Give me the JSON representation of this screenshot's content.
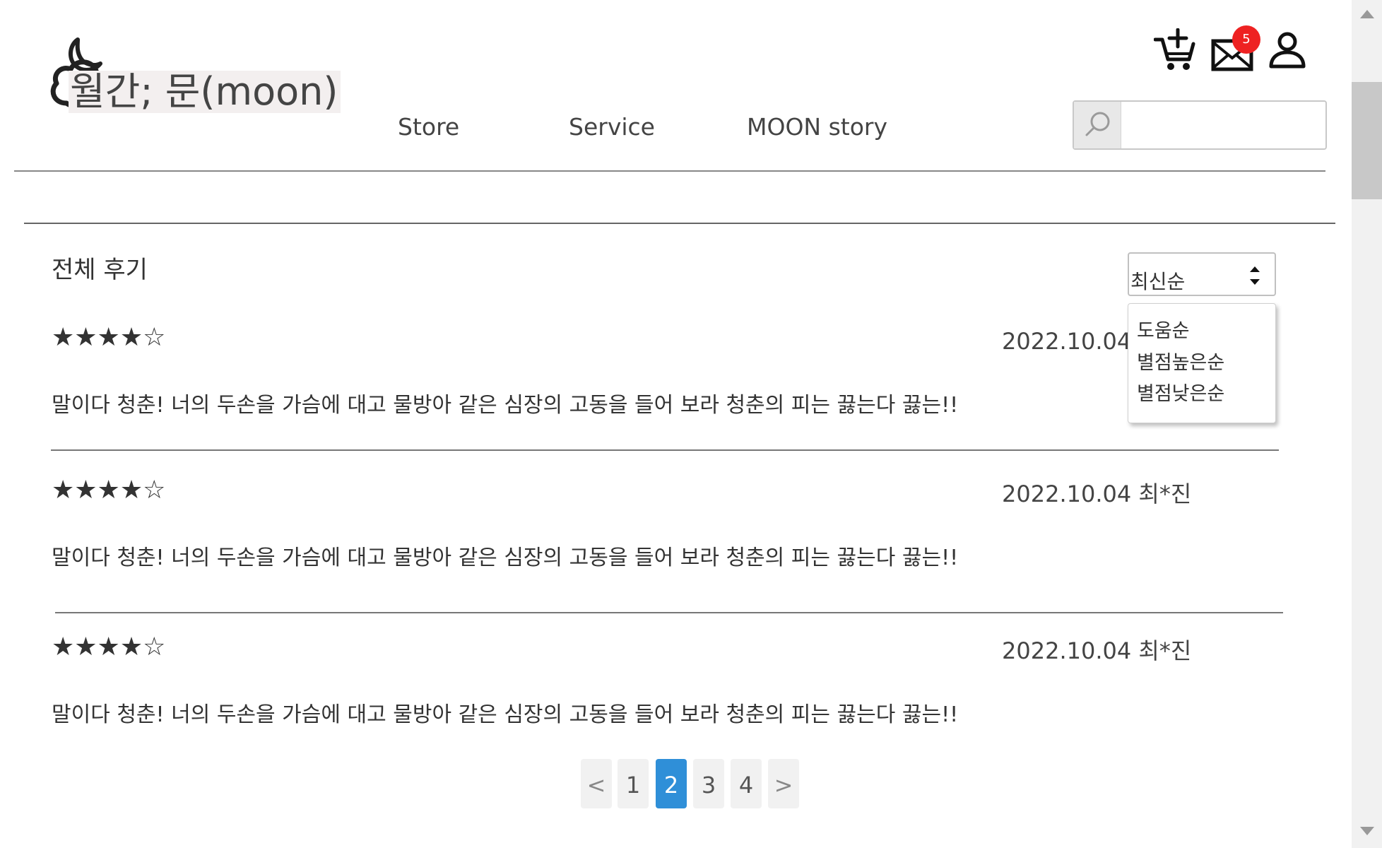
{
  "header": {
    "logo_text": "월간; 문(moon)",
    "nav": [
      "Store",
      "Service",
      "MOON story"
    ],
    "mail_badge": "5",
    "search": {
      "placeholder": "",
      "value": ""
    }
  },
  "section": {
    "title": "전체 후기",
    "sort": {
      "selected": "최신순",
      "options": [
        "도움순",
        "별점높은순",
        "별점낮은순"
      ]
    }
  },
  "reviews": [
    {
      "rating": 4,
      "stars": "★★★★☆",
      "date_author": "2022.10.04 최*진",
      "text": "말이다 청춘! 너의 두손을 가슴에 대고 물방아 같은 심장의 고동을 들어 보라 청춘의 피는 끓는다 끓는!!"
    },
    {
      "rating": 4,
      "stars": "★★★★☆",
      "date_author": "2022.10.04 최*진",
      "text": "말이다 청춘! 너의 두손을 가슴에 대고 물방아 같은 심장의 고동을 들어 보라 청춘의 피는 끓는다 끓는!!"
    },
    {
      "rating": 4,
      "stars": "★★★★☆",
      "date_author": "2022.10.04 최*진",
      "text": "말이다 청춘! 너의 두손을 가슴에 대고 물방아 같은 심장의 고동을 들어 보라 청춘의 피는 끓는다 끓는!!"
    }
  ],
  "pagination": {
    "prev": "<",
    "pages": [
      "1",
      "2",
      "3",
      "4"
    ],
    "current": "2",
    "next": ">"
  },
  "colors": {
    "accent": "#2f8fd8",
    "badge": "#ee2222",
    "logo_bg": "#f3efef"
  },
  "icons": [
    "moon-cloud-logo-icon",
    "add-to-cart-icon",
    "mail-icon",
    "user-icon",
    "search-icon",
    "sort-arrows-icon"
  ]
}
